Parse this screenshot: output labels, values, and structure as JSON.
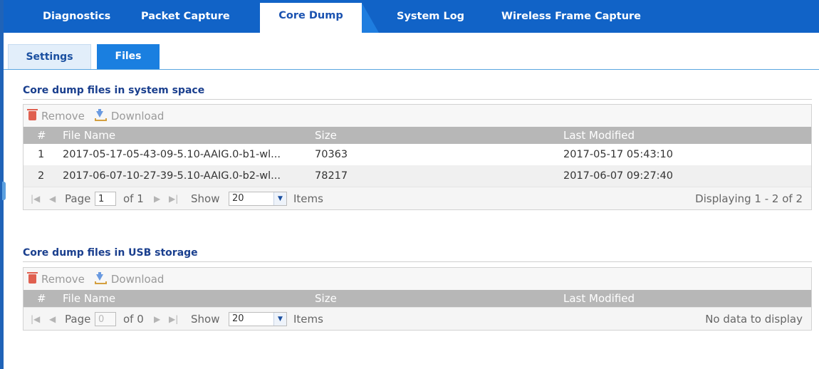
{
  "tabs": [
    {
      "label": "Diagnostics"
    },
    {
      "label": "Packet Capture"
    },
    {
      "label": "Core Dump"
    },
    {
      "label": "System Log"
    },
    {
      "label": "Wireless Frame Capture"
    }
  ],
  "subtabs": [
    {
      "label": "Settings"
    },
    {
      "label": "Files"
    }
  ],
  "toolbar": {
    "remove_label": "Remove",
    "download_label": "Download"
  },
  "columns": {
    "num": "#",
    "file_name": "File Name",
    "size": "Size",
    "last_modified": "Last Modified"
  },
  "system_space": {
    "title": "Core dump files in system space",
    "rows": [
      {
        "num": "1",
        "file_name": "2017-05-17-05-43-09-5.10-AAIG.0-b1-wl...",
        "size": "70363",
        "last_modified": "2017-05-17 05:43:10"
      },
      {
        "num": "2",
        "file_name": "2017-06-07-10-27-39-5.10-AAIG.0-b2-wl...",
        "size": "78217",
        "last_modified": "2017-06-07 09:27:40"
      }
    ],
    "pager": {
      "page_label": "Page",
      "page_value": "1",
      "of_label": "of 1",
      "show_label": "Show",
      "show_value": "20",
      "items_label": "Items",
      "status": "Displaying 1 - 2 of 2"
    }
  },
  "usb_storage": {
    "title": "Core dump files in USB storage",
    "pager": {
      "page_label": "Page",
      "page_value": "0",
      "of_label": "of 0",
      "show_label": "Show",
      "show_value": "20",
      "items_label": "Items",
      "status": "No data to display"
    }
  },
  "colors": {
    "tab_bar": "#1163c7",
    "active_subtab": "#1a7fe0",
    "section_title": "#1a3f8e",
    "header_row": "#b7b7b7"
  }
}
